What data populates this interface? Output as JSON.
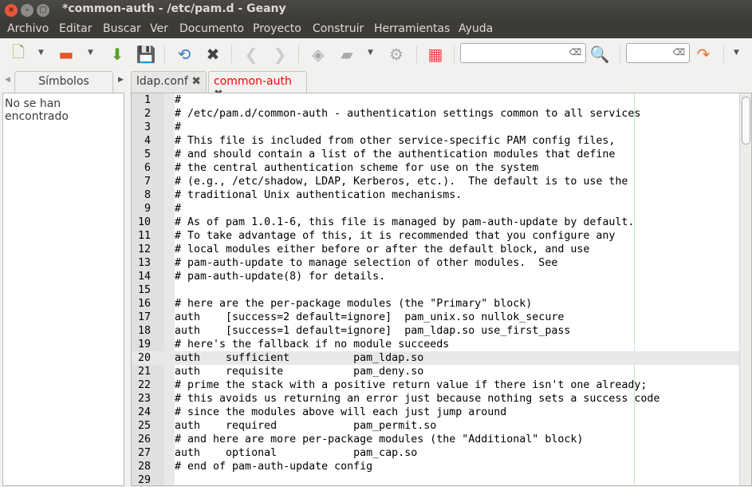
{
  "window": {
    "title": "*common-auth - /etc/pam.d - Geany"
  },
  "menu": [
    "Archivo",
    "Editar",
    "Buscar",
    "Ver",
    "Documento",
    "Proyecto",
    "Construir",
    "Herramientas",
    "Ayuda"
  ],
  "sidebar": {
    "tab": "Símbolos",
    "message": "No se han encontrado"
  },
  "tabs": [
    {
      "label": "ldap.conf",
      "active": false
    },
    {
      "label": "common-auth",
      "active": true,
      "color": "#ff0000"
    }
  ],
  "search": {
    "value": "",
    "goto_value": ""
  },
  "editor": {
    "current_line": 20,
    "lines": [
      "#",
      "# /etc/pam.d/common-auth - authentication settings common to all services",
      "#",
      "# This file is included from other service-specific PAM config files,",
      "# and should contain a list of the authentication modules that define",
      "# the central authentication scheme for use on the system",
      "# (e.g., /etc/shadow, LDAP, Kerberos, etc.).  The default is to use the",
      "# traditional Unix authentication mechanisms.",
      "#",
      "# As of pam 1.0.1-6, this file is managed by pam-auth-update by default.",
      "# To take advantage of this, it is recommended that you configure any",
      "# local modules either before or after the default block, and use",
      "# pam-auth-update to manage selection of other modules.  See",
      "# pam-auth-update(8) for details.",
      "",
      "# here are the per-package modules (the \"Primary\" block)",
      "auth    [success=2 default=ignore]  pam_unix.so nullok_secure",
      "auth    [success=1 default=ignore]  pam_ldap.so use_first_pass",
      "# here's the fallback if no module succeeds",
      "auth    sufficient          pam_ldap.so",
      "auth    requisite           pam_deny.so",
      "# prime the stack with a positive return value if there isn't one already;",
      "# this avoids us returning an error just because nothing sets a success code",
      "# since the modules above will each just jump around",
      "auth    required            pam_permit.so",
      "# and here are more per-package modules (the \"Additional\" block)",
      "auth    optional            pam_cap.so",
      "# end of pam-auth-update config",
      ""
    ]
  }
}
